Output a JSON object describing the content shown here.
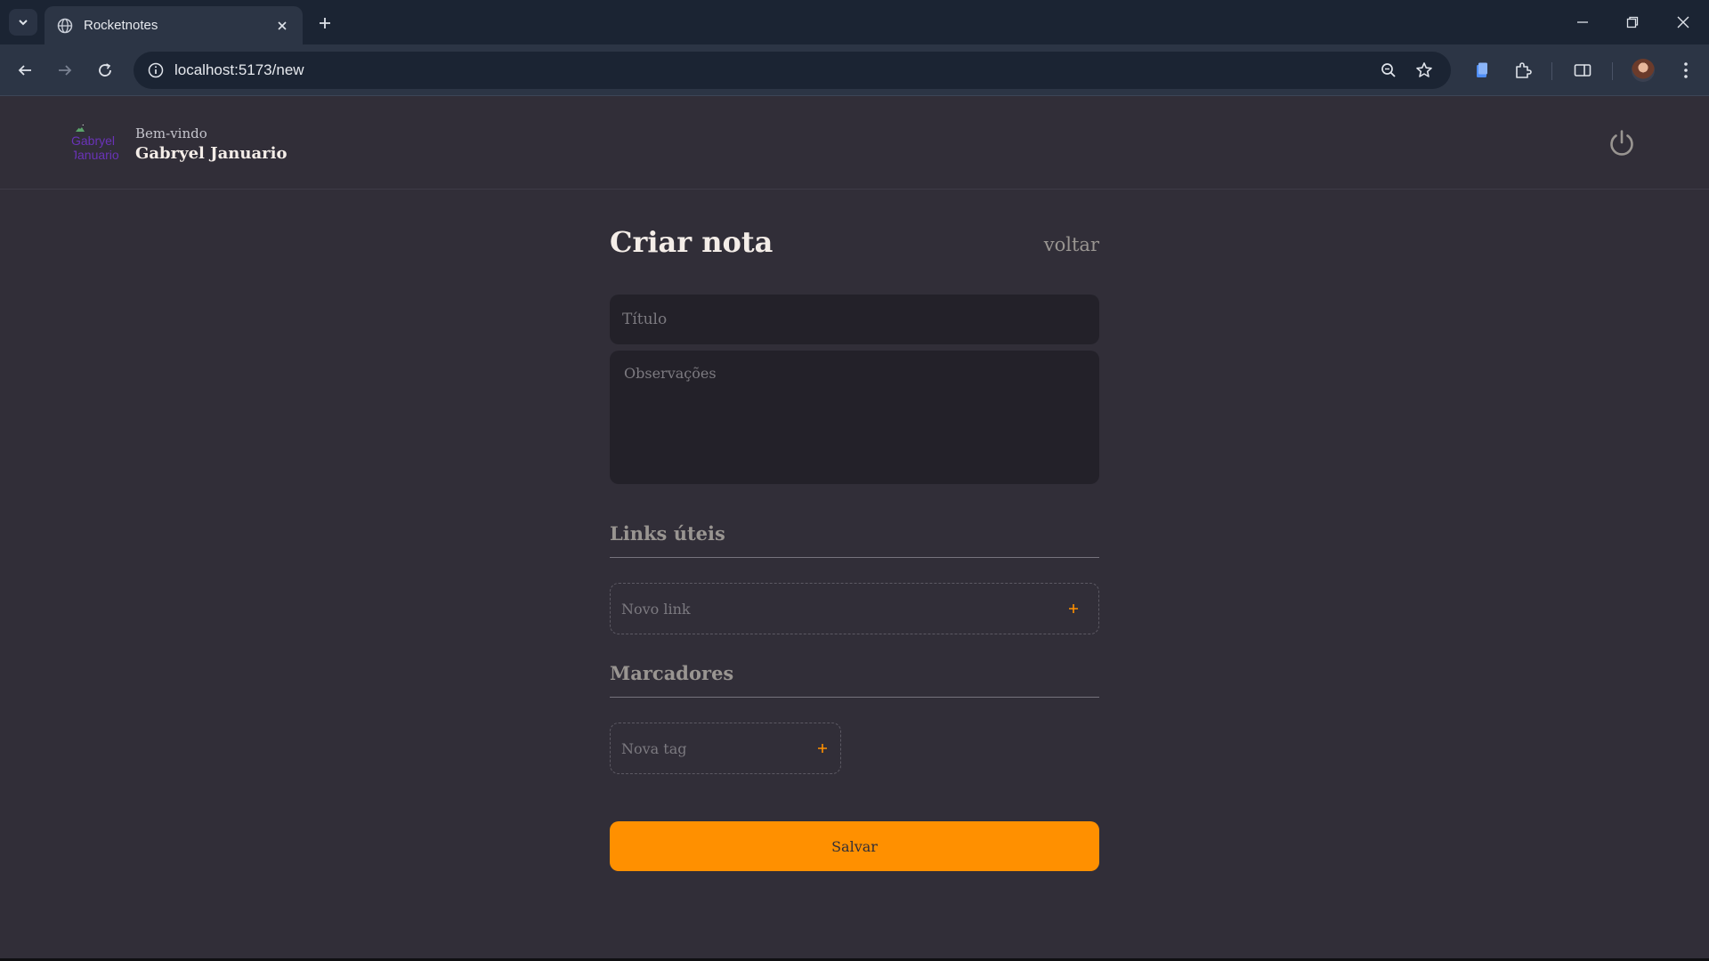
{
  "browser": {
    "tab_title": "Rocketnotes",
    "url": "localhost:5173/new"
  },
  "header": {
    "avatar_alt": "Gabryel Januario",
    "welcome": "Bem-vindo",
    "user_name": "Gabryel Januario"
  },
  "form": {
    "title": "Criar nota",
    "back_label": "voltar",
    "title_placeholder": "Título",
    "notes_placeholder": "Observações",
    "links_section": "Links úteis",
    "new_link_placeholder": "Novo link",
    "tags_section": "Marcadores",
    "new_tag_placeholder": "Nova tag",
    "save_label": "Salvar"
  },
  "colors": {
    "background": "#312e38",
    "input_bg": "#232129",
    "accent": "#ff9000",
    "text": "#f4ede8",
    "muted": "#999591"
  },
  "icons": {
    "tab_list": "chevron-down-icon",
    "favicon": "globe-icon",
    "close_tab": "close-icon",
    "new_tab": "plus-icon",
    "back": "arrow-left-icon",
    "forward": "arrow-right-icon",
    "reload": "reload-icon",
    "site_info": "info-icon",
    "zoom": "zoom-out-icon",
    "bookmark": "star-icon",
    "logout": "power-icon",
    "add": "plus-icon"
  }
}
